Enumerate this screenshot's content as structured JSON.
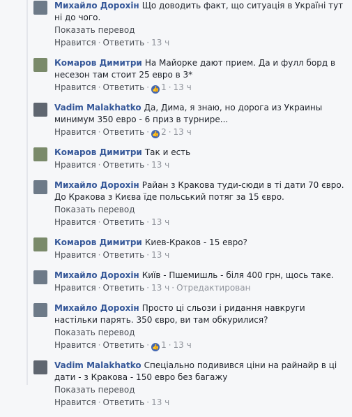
{
  "comments": [
    {
      "author": "Михайло Дорохін",
      "text": "Що доводить факт, що ситуація в Україні тут ні до чого.",
      "translate": "Показать перевод",
      "like": "Нравится",
      "reply": "Ответить",
      "likes": "",
      "time": "13 ч",
      "edited": "",
      "avatar_color": "#6d7a88"
    },
    {
      "author": "Комаров Димитри",
      "text": "На Майорке дают прием. Да и фулл борд в несезон там стоит 25 евро в 3*",
      "translate": "",
      "like": "Нравится",
      "reply": "Ответить",
      "likes": "1",
      "time": "13 ч",
      "edited": "",
      "avatar_color": "#7a8a6a"
    },
    {
      "author": "Vadim Malakhatko",
      "text": "Да, Дима, я знаю, но дорога из Украины минимум 350 евро - 6 приз в турнире...",
      "translate": "",
      "like": "Нравится",
      "reply": "Ответить",
      "likes": "2",
      "time": "13 ч",
      "edited": "",
      "avatar_color": "#5f6670"
    },
    {
      "author": "Комаров Димитри",
      "text": "Так и есть",
      "translate": "",
      "like": "Нравится",
      "reply": "Ответить",
      "likes": "",
      "time": "13 ч",
      "edited": "",
      "avatar_color": "#7a8a6a"
    },
    {
      "author": "Михайло Дорохін",
      "text": "Райан з Кракова туди-сюди в ті дати 70 євро. До Кракова з Києва їде польський потяг за 15 євро.",
      "translate": "Показать перевод",
      "like": "Нравится",
      "reply": "Ответить",
      "likes": "",
      "time": "13 ч",
      "edited": "",
      "avatar_color": "#6d7a88"
    },
    {
      "author": "Комаров Димитри",
      "text": "Киев-Краков - 15 евро?",
      "translate": "",
      "like": "Нравится",
      "reply": "Ответить",
      "likes": "",
      "time": "13 ч",
      "edited": "",
      "avatar_color": "#7a8a6a"
    },
    {
      "author": "Михайло Дорохін",
      "text": "Київ - Пшемишль - біля 400 грн, щось таке.",
      "translate": "",
      "like": "Нравится",
      "reply": "Ответить",
      "likes": "",
      "time": "13 ч",
      "edited": "Отредактирован",
      "avatar_color": "#6d7a88"
    },
    {
      "author": "Михайло Дорохін",
      "text": "Просто ці сльози і ридання навкруги настільки парять. 350 євро, ви там обкурилися?",
      "translate": "Показать перевод",
      "like": "Нравится",
      "reply": "Ответить",
      "likes": "1",
      "time": "13 ч",
      "edited": "",
      "avatar_color": "#6d7a88"
    },
    {
      "author": "Vadim Malakhatko",
      "text": "Спеціально подивився ціни на райнайр в ці дати - з Кракова - 150 евро без багажу",
      "translate": "Показать перевод",
      "like": "Нравится",
      "reply": "Ответить",
      "likes": "",
      "time": "13 ч",
      "edited": "",
      "avatar_color": "#5f6670"
    }
  ]
}
